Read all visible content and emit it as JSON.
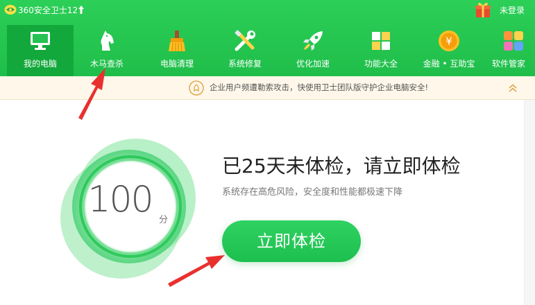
{
  "window": {
    "title": "360安全卫士12",
    "login_label": "未登录"
  },
  "colors": {
    "brand_green": "#1fbe4a",
    "active_tab": "#12a83b",
    "button_green": "#22c456",
    "annotation_red": "#e8312f"
  },
  "nav": {
    "items": [
      {
        "label": "我的电脑",
        "icon": "monitor-icon",
        "active": true
      },
      {
        "label": "木马查杀",
        "icon": "horse-icon"
      },
      {
        "label": "电脑清理",
        "icon": "broom-icon"
      },
      {
        "label": "系统修复",
        "icon": "tools-icon"
      },
      {
        "label": "优化加速",
        "icon": "rocket-icon"
      },
      {
        "label": "功能大全",
        "icon": "apps-grid-icon"
      },
      {
        "label": "金融 • 互助宝",
        "icon": "yen-coin-icon"
      },
      {
        "label": "软件管家",
        "icon": "software-icon"
      }
    ]
  },
  "notice": {
    "text": "企业用户频遭勒索攻击，快使用卫士团队版守护企业电脑安全!"
  },
  "main": {
    "score": "100",
    "score_unit": "分",
    "headline": "已25天未体检，请立即体检",
    "subline": "系统存在高危风险，安全度和性能都极速下降",
    "check_button": "立即体检"
  }
}
